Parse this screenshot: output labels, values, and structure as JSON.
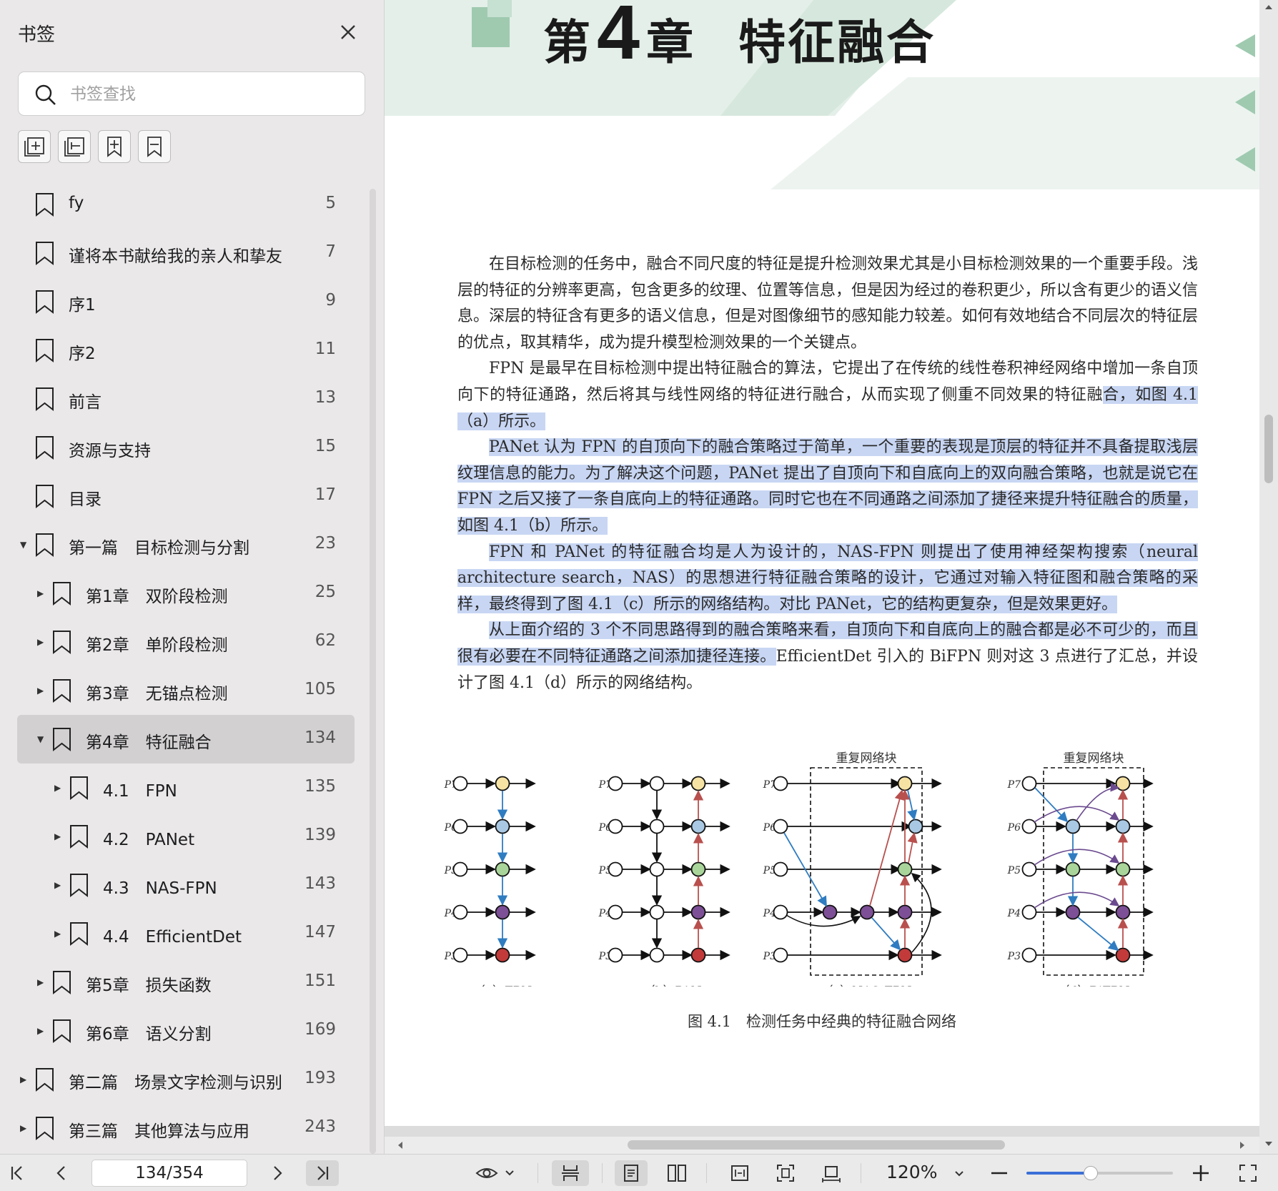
{
  "sidebar": {
    "title": "书签",
    "search_placeholder": "书签查找",
    "bookmarks": [
      {
        "label": "fy",
        "page": "5",
        "level": 0,
        "expander": ""
      },
      {
        "label": "谨将本书献给我的亲人和挚友",
        "page": "7",
        "level": 0,
        "expander": ""
      },
      {
        "label": "序1",
        "page": "9",
        "level": 0,
        "expander": ""
      },
      {
        "label": "序2",
        "page": "11",
        "level": 0,
        "expander": ""
      },
      {
        "label": "前言",
        "page": "13",
        "level": 0,
        "expander": ""
      },
      {
        "label": "资源与支持",
        "page": "15",
        "level": 0,
        "expander": ""
      },
      {
        "label": "目录",
        "page": "17",
        "level": 0,
        "expander": ""
      },
      {
        "label": "第一篇　目标检测与分割",
        "page": "23",
        "level": 0,
        "expander": "open"
      },
      {
        "label": "第1章　双阶段检测",
        "page": "25",
        "level": 1,
        "expander": "closed"
      },
      {
        "label": "第2章　单阶段检测",
        "page": "62",
        "level": 1,
        "expander": "closed"
      },
      {
        "label": "第3章　无锚点检测",
        "page": "105",
        "level": 1,
        "expander": "closed"
      },
      {
        "label": "第4章　特征融合",
        "page": "134",
        "level": 1,
        "expander": "open",
        "selected": true
      },
      {
        "label": "4.1　FPN",
        "page": "135",
        "level": 2,
        "expander": "closed"
      },
      {
        "label": "4.2　PANet",
        "page": "139",
        "level": 2,
        "expander": "closed"
      },
      {
        "label": "4.3　NAS-FPN",
        "page": "143",
        "level": 2,
        "expander": "closed"
      },
      {
        "label": "4.4　EfficientDet",
        "page": "147",
        "level": 2,
        "expander": "closed"
      },
      {
        "label": "第5章　损失函数",
        "page": "151",
        "level": 1,
        "expander": "closed"
      },
      {
        "label": "第6章　语义分割",
        "page": "169",
        "level": 1,
        "expander": "closed"
      },
      {
        "label": "第二篇　场景文字检测与识别",
        "page": "193",
        "level": 0,
        "expander": "closed"
      },
      {
        "label": "第三篇　其他算法与应用",
        "page": "243",
        "level": 0,
        "expander": "closed"
      }
    ]
  },
  "document": {
    "chapter_prefix": "第",
    "chapter_num": "4",
    "chapter_suffix": "章",
    "chapter_title": "特征融合",
    "para1": "在目标检测的任务中，融合不同尺度的特征是提升检测效果尤其是小目标检测效果的一个重要手段。浅层的特征的分辨率更高，包含更多的纹理、位置等信息，但是因为经过的卷积更少，所以含有更少的语义信息。深层的特征含有更多的语义信息，但是对图像细节的感知能力较差。如何有效地结合不同层次的特征层的优点，取其精华，成为提升模型检测效果的一个关键点。",
    "para2_a": "FPN 是最早在目标检测中提出特征融合的算法，它提出了在传统的线性卷积神经网络中增加一条自顶向下的特征通路，然后将其与线性网络的特征进行融合，从而实现了侧重不同效果的特征融",
    "para2_b": "合，如图 4.1（a）所示。",
    "para3": "PANet 认为 FPN 的自顶向下的融合策略过于简单，一个重要的表现是顶层的特征并不具备提取浅层纹理信息的能力。为了解决这个问题，PANet 提出了自顶向下和自底向上的双向融合策略，也就是说它在 FPN 之后又接了一条自底向上的特征通路。同时它也在不同通路之间添加了捷径来提升特征融合的质量，如图 4.1（b）所示。",
    "para4": "FPN 和 PANet 的特征融合均是人为设计的，NAS-FPN 则提出了使用神经架构搜索（neural architecture search，NAS）的思想进行特征融合策略的设计，它通过对输入特征图和融合策略的采样，最终得到了图 4.1（c）所示的网络结构。对比 PANet，它的结构更复杂，但是效果更好。",
    "para5_a": "从上面介绍的 3 个不同思路得到的融合策略来看，自顶向下和自底向上的融合都是必不可少的，而且很有必要在不同特征通路之间添加捷径连接。",
    "para5_b": "EfficientDet 引入的 BiFPN 则对这 3 点进行了汇总，并设计了图 4.1（d）所示的网络结构。",
    "figure": {
      "repeat_label_c": "重复网络块",
      "repeat_label_d": "重复网络块",
      "levels": [
        "P7",
        "P6",
        "P5",
        "P4",
        "P3"
      ],
      "sub_a": "（a）FPN",
      "sub_b": "（b）PANet",
      "sub_c": "（c）NAS-FPN",
      "sub_d": "（d）BiFPN",
      "caption": "图 4.1　检测任务中经典的特征融合网络",
      "colors": {
        "p7": "#f6e3a3",
        "p6": "#a9c8e3",
        "p5": "#a9d59a",
        "p4": "#7d4f96",
        "p3": "#c23a3a",
        "blue": "#2f7cc1",
        "red": "#b8504e",
        "purple": "#6b4a8f"
      }
    }
  },
  "toolbar": {
    "page_indicator": "134/354",
    "zoom": "120%",
    "zoom_slider_percent": 44
  },
  "colors": {
    "accent": "#3a6fd8",
    "highlight": "#c8d6f3",
    "header_green": "#e4efe9",
    "header_deep_green": "#9fcab0"
  }
}
